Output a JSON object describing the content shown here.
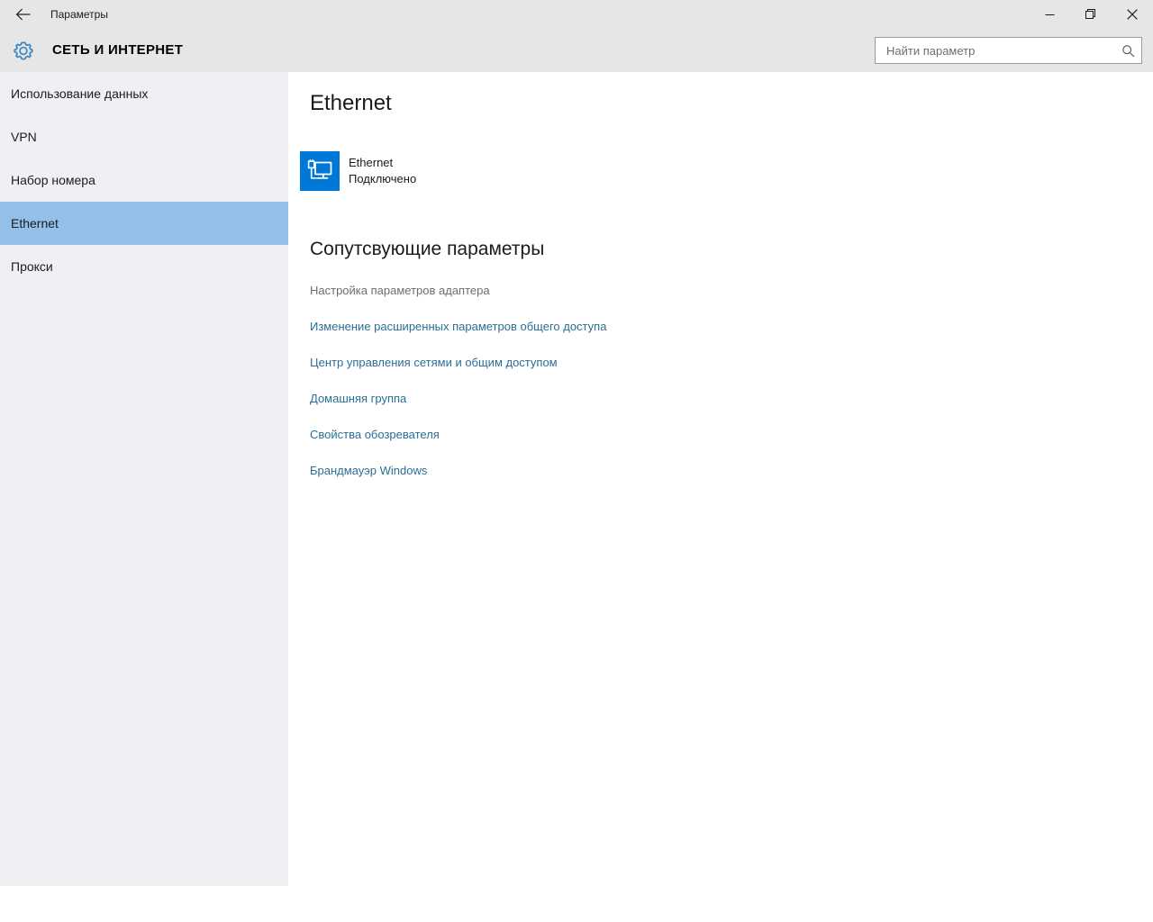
{
  "window": {
    "title": "Параметры",
    "back_label": "←",
    "controls": {
      "minimize": "Свернуть",
      "restore": "Развернуть",
      "close": "Закрыть"
    }
  },
  "header": {
    "category": "СЕТЬ И ИНТЕРНЕТ",
    "gear_icon": "gear-icon"
  },
  "search": {
    "placeholder": "Найти параметр",
    "value": "",
    "icon": "search-icon"
  },
  "sidebar": {
    "items": [
      {
        "label": "Использование данных",
        "selected": false
      },
      {
        "label": "VPN",
        "selected": false
      },
      {
        "label": "Набор номера",
        "selected": false
      },
      {
        "label": "Ethernet",
        "selected": true
      },
      {
        "label": "Прокси",
        "selected": false
      }
    ]
  },
  "main": {
    "page_title": "Ethernet",
    "adapter": {
      "icon": "ethernet-monitor-icon",
      "name": "Ethernet",
      "status": "Подключено"
    },
    "related": {
      "title": "Сопутсвующие параметры",
      "subtitle": "Настройка параметров адаптера",
      "links": [
        "Изменение расширенных параметров общего доступа",
        "Центр управления сетями и общим доступом",
        "Домашняя группа",
        "Свойства обозревателя",
        "Брандмауэр Windows"
      ]
    }
  },
  "colors": {
    "accent": "#0078d7",
    "selection": "#92c0e8",
    "link": "#2a6f95",
    "chrome": "#e6e6e6",
    "sidebar": "#f2eff4",
    "muted_text": "#6e6e6e"
  }
}
